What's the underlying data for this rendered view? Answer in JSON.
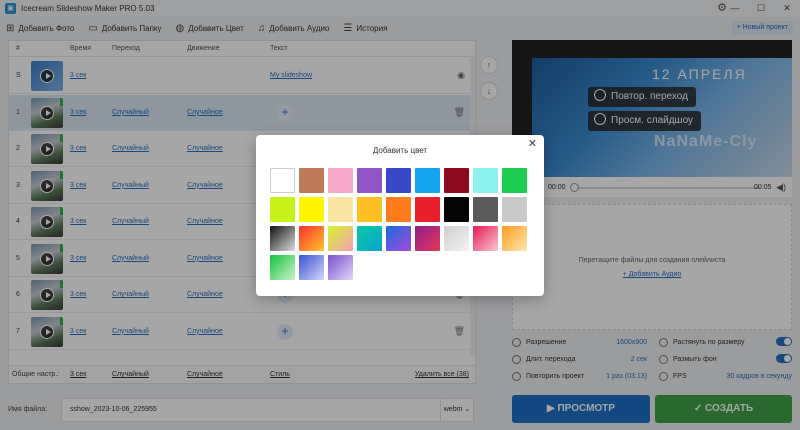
{
  "window": {
    "title": "Icecream Slideshow Maker PRO 5.03",
    "minimize": "—",
    "maximize": "☐",
    "close": "✕"
  },
  "toolbar": {
    "add_photo": "Добавить Фото",
    "add_folder": "Добавить Папку",
    "add_color": "Добавить Цвет",
    "add_audio": "Добавить Аудио",
    "history": "История",
    "new_project": "+ Новый проект"
  },
  "list": {
    "headers": {
      "num": "#",
      "time": "Время",
      "transition": "Переход",
      "motion": "Движение",
      "text": "Текст"
    },
    "rows": [
      {
        "num": "S",
        "time": "3 сек",
        "transition": "",
        "motion": "",
        "text": "My slideshow",
        "thumb": "blue"
      },
      {
        "num": "1",
        "time": "3 сек",
        "transition": "Случайный",
        "motion": "Случайное",
        "text": "",
        "thumb": "photo"
      },
      {
        "num": "2",
        "time": "3 сек",
        "transition": "Случайный",
        "motion": "Случайное",
        "text": "",
        "thumb": "photo"
      },
      {
        "num": "3",
        "time": "3 сек",
        "transition": "Случайный",
        "motion": "Случайное",
        "text": "",
        "thumb": "photo"
      },
      {
        "num": "4",
        "time": "3 сек",
        "transition": "Случайный",
        "motion": "Случайное",
        "text": "",
        "thumb": "photo"
      },
      {
        "num": "5",
        "time": "3 сек",
        "transition": "Случайный",
        "motion": "Случайное",
        "text": "",
        "thumb": "photo"
      },
      {
        "num": "6",
        "time": "3 сек",
        "transition": "Случайный",
        "motion": "Случайное",
        "text": "",
        "thumb": "photo"
      },
      {
        "num": "7",
        "time": "3 сек",
        "transition": "Случайный",
        "motion": "Случайное",
        "text": "",
        "thumb": "photo"
      }
    ],
    "footer": {
      "label": "Общие настр.:",
      "time": "3 сек",
      "transition": "Случайный",
      "motion": "Случайное",
      "style": "Стиль",
      "delete_all": "Удалить все (38)"
    }
  },
  "preview": {
    "replay_transition": "Повтор. переход",
    "view_slideshow": "Просм. слайдшоу",
    "poster_line1": "12 АПРЕЛЯ",
    "poster_line2": "NaNaMe-Cly",
    "time_start": "00:00",
    "time_end": "00:05"
  },
  "playlist": {
    "hint": "Перетащите файлы для создания плейлиста",
    "add_audio": "+ Добавить Аудио"
  },
  "settings": {
    "resolution_label": "Разрешение",
    "resolution_value": "1600x900",
    "transition_length_label": "Длит. перехода",
    "transition_length_value": "2 сек",
    "repeat_label": "Повторить проект",
    "repeat_value": "1 раз (03:13)",
    "stretch_label": "Растянуть по размеру",
    "blur_bg_label": "Размыть фон",
    "fps_label": "FPS",
    "fps_value": "30 кадров в секунду"
  },
  "file": {
    "label": "Имя файла:",
    "name": "sshow_2023-10-06_225955",
    "format": "webm ⌄"
  },
  "actions": {
    "preview": "▶  ПРОСМОТР",
    "create": "✓  СОЗДАТЬ"
  },
  "modal": {
    "title": "Добавить цвет",
    "close": "✕",
    "swatches": [
      "#ffffff",
      "#bb7a58",
      "#f5a9c8",
      "#9156c6",
      "#3848c6",
      "#14a3ee",
      "#8e0a1e",
      "#8df2ee",
      "#1ccd4f",
      "#c6f21a",
      "#fef400",
      "#fae5a4",
      "#fec020",
      "#fe7c1c",
      "#e8202c",
      "#050505",
      "#5a5a5a",
      "#c9c9c9",
      "linear-gradient(135deg,#111,#ddd)",
      "linear-gradient(135deg,#fe2d2d,#fec72d)",
      "linear-gradient(135deg,#d6f52a,#f3a0ba)",
      "linear-gradient(135deg,#08c9a0,#0aa4d0)",
      "linear-gradient(135deg,#1b6ae0,#a44bd8)",
      "linear-gradient(135deg,#8d1f8a,#e73659)",
      "linear-gradient(135deg,#cfcfcf,#f3f3f3)",
      "linear-gradient(135deg,#e5194d,#f9c7d4)",
      "linear-gradient(135deg,#fe9b1f,#fde8b0)",
      "linear-gradient(135deg,#16c33b,#cbf2cc)",
      "linear-gradient(135deg,#3b4fd4,#d2d8f7)",
      "linear-gradient(135deg,#7a4fcf,#e1d6f6)"
    ]
  }
}
